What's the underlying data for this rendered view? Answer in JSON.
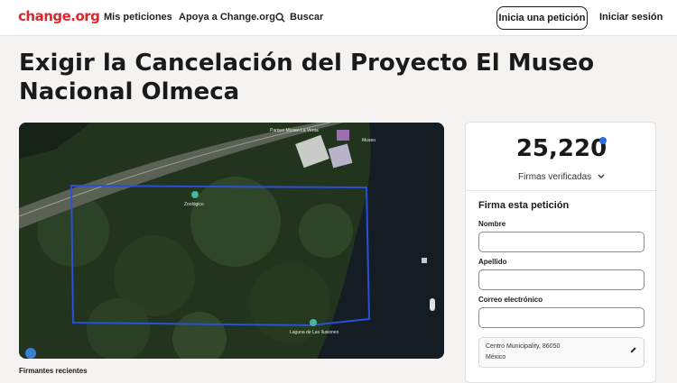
{
  "header": {
    "logo": "change.org",
    "nav": [
      "Mis peticiones",
      "Apoya a Change.org",
      "Buscar"
    ],
    "start_petition": "Inicia una petición",
    "login": "Iniciar sesión"
  },
  "petition": {
    "title": "Exigir la Cancelación del Proyecto El Museo Nacional Olmeca",
    "recent_signers": "Firmantes recientes"
  },
  "map": {
    "labels": [
      "Parque Museo La Venta",
      "Museo",
      "Zoológico",
      "Laguna de Las Ilusiones"
    ]
  },
  "signatures": {
    "count": "25,220",
    "verified_label": "Firmas verificadas"
  },
  "form": {
    "title": "Firma esta petición",
    "first_name_label": "Nombre",
    "last_name_label": "Apellido",
    "email_label": "Correo electrónico",
    "location_line1": "Centro Municipality, 86050",
    "location_line2": "México"
  },
  "colors": {
    "brand": "#e0262d",
    "verified": "#2a6fdb",
    "map_outline": "#2a4fd8"
  }
}
